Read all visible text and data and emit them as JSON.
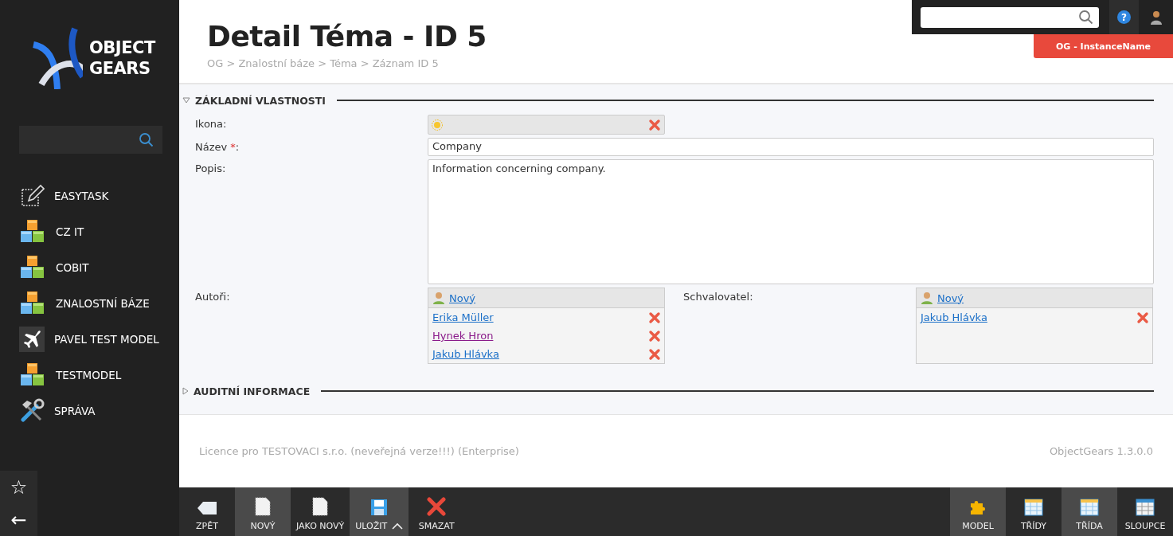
{
  "sidebar": {
    "logo": {
      "line_1": "OBJECT",
      "line_2": "GEARS"
    },
    "items": [
      {
        "label": "EASYTASK",
        "kind": "edit"
      },
      {
        "label": "CZ IT",
        "kind": "cubes"
      },
      {
        "label": "COBIT",
        "kind": "cubes"
      },
      {
        "label": "ZNALOSTNÍ BÁZE",
        "kind": "cubes"
      },
      {
        "label": "PAVEL TEST MODEL",
        "kind": "plane"
      },
      {
        "label": "TESTMODEL",
        "kind": "cubes"
      },
      {
        "label": "SPRÁVA",
        "kind": "tools"
      }
    ],
    "bottom_buttons": [
      "☆",
      "←"
    ]
  },
  "header": {
    "title": "Detail Téma - ID 5",
    "breadcrumb": "OG > Znalostní báze > Téma > Záznam ID 5",
    "instance_badge": "OG - InstanceName",
    "help_button": "?"
  },
  "sections": [
    {
      "title": "ZÁKLADNÍ VLASTNOSTI",
      "expanded": true,
      "fields": [
        {
          "kind": "icon",
          "label": "Ikona:"
        },
        {
          "kind": "text",
          "label": "Název",
          "required_mark": "*",
          "label_end": ":",
          "value": "Company"
        },
        {
          "kind": "textarea",
          "label": "Popis:",
          "value": "Information concerning company."
        },
        {
          "kind": "people",
          "label": "Autoři:",
          "new_link": "Nový",
          "people": [
            {
              "name": "Erika Müller",
              "visited": false
            },
            {
              "name": "Hynek Hron",
              "visited": true
            },
            {
              "name": "Jakub Hlávka",
              "visited": false
            }
          ],
          "side": {
            "label": "Schvalovatel:",
            "new_link": "Nový",
            "people": [
              {
                "name": "Jakub Hlávka",
                "visited": false
              }
            ]
          }
        }
      ]
    },
    {
      "title": "AUDITNÍ INFORMACE",
      "expanded": false
    }
  ],
  "footer": {
    "licence": "Licence pro TESTOVACI s.r.o. (neveřejná verze!!!) (Enterprise)",
    "version": "ObjectGears 1.3.0.0"
  },
  "toolbar": {
    "left": [
      {
        "label": "ZPĚT",
        "kind": "back",
        "shaded": false
      },
      {
        "label": "NOVÝ",
        "kind": "page",
        "shaded": true
      },
      {
        "label": "JAKO NOVÝ",
        "kind": "page",
        "shaded": false
      },
      {
        "label": "ULOŽIT",
        "kind": "save",
        "shaded": true
      },
      {
        "label": "SMAZAT",
        "kind": "delete",
        "shaded": false
      }
    ],
    "right": [
      {
        "label": "MODEL",
        "kind": "puzzle",
        "shaded": true
      },
      {
        "label": "TŘÍDY",
        "kind": "table",
        "shaded": false
      },
      {
        "label": "TŘÍDA",
        "kind": "table",
        "shaded": true
      },
      {
        "label": "SLOUPCE",
        "kind": "columns",
        "shaded": false
      }
    ]
  }
}
